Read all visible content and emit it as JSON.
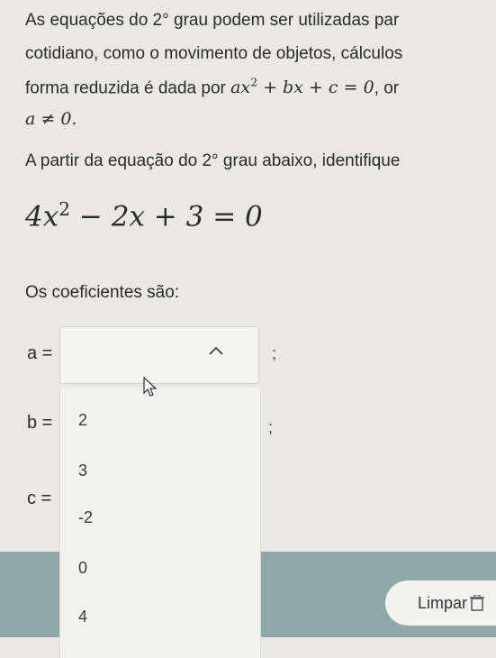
{
  "text": {
    "line1_pre": "As equações do ",
    "line1_deg": "2°",
    "line1_post": " grau podem ser utilizadas par",
    "line2": "cotidiano, como o movimento de objetos, cálculos",
    "line3_pre": "forma reduzida é dada por ",
    "line3_post": ", or",
    "line4_math": "a ≠ 0.",
    "line5_pre": "A partir da equação do ",
    "line5_deg": "2°",
    "line5_post": " grau abaixo, identifique",
    "coef_title": "Os coeficientes são:"
  },
  "formula": {
    "general_a": "ax",
    "general_exp": "2",
    "general_rest": " + bx + c = 0",
    "eq_a": "4x",
    "eq_exp": "2",
    "eq_rest": " − 2x + 3 = 0"
  },
  "fields": {
    "a_label": "a =",
    "b_label": "b =",
    "c_label": "c =",
    "separator": ";",
    "a_selected_value": ""
  },
  "dropdown": {
    "options": [
      "2",
      "3",
      "-2",
      "0",
      "4"
    ]
  },
  "footer": {
    "clear_label": "Limpar"
  },
  "icons": {
    "caret": "chevron-up-icon",
    "cursor": "mouse-pointer-icon",
    "trash": "trash-icon"
  }
}
